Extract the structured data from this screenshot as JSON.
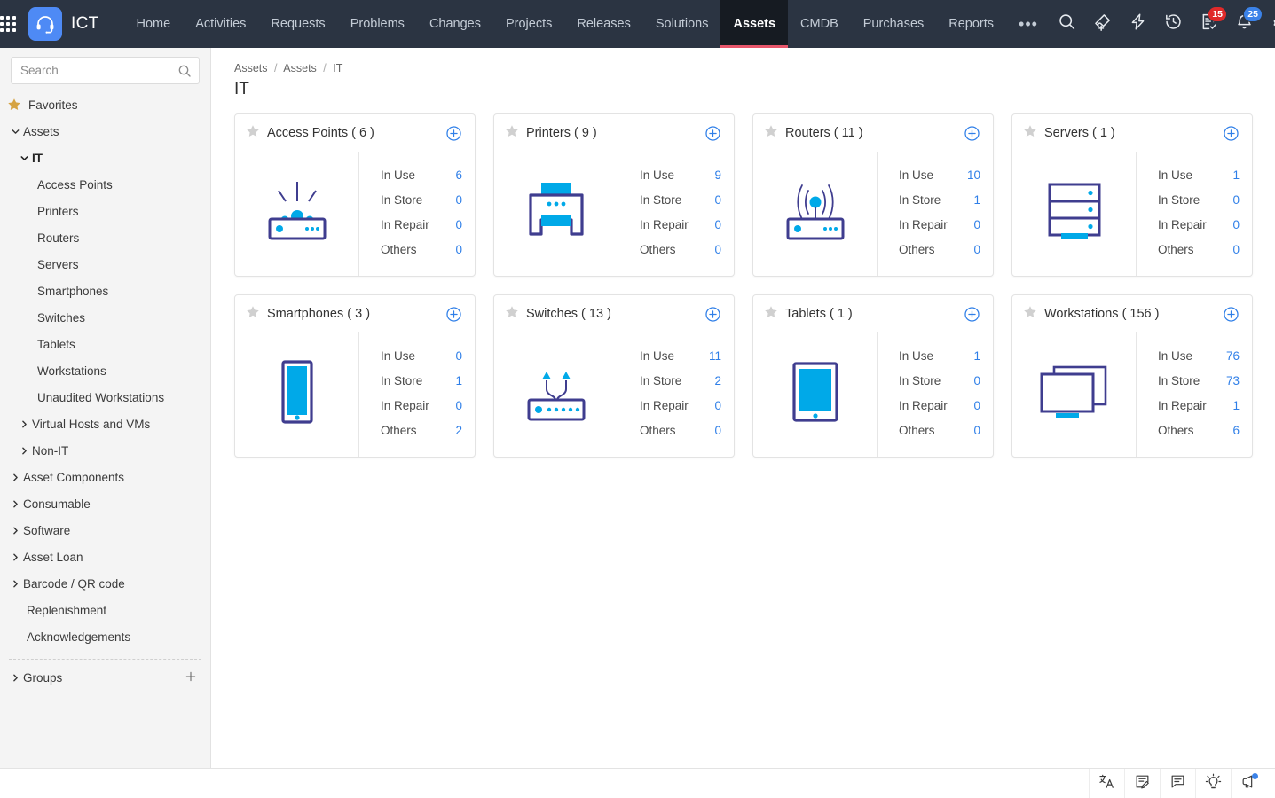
{
  "colors": {
    "nav_bg": "#2b3442",
    "active_tab_bg": "#161b22",
    "accent_red": "#e8566b",
    "brand_blue": "#4e8af5",
    "link_blue": "#2f7fe8",
    "illus_dark": "#3f3d8f",
    "illus_cyan": "#00a9e8",
    "badge_red": "#e02a2a",
    "badge_blue": "#3b82e8",
    "status_green": "#17c13e",
    "favorites_gold": "#d6a341"
  },
  "topbar": {
    "apps_icon": "grid-apps-icon",
    "brand": {
      "name": "ICT",
      "icon": "headset-logo-icon"
    },
    "links": [
      {
        "label": "Home",
        "active": false
      },
      {
        "label": "Activities",
        "active": false
      },
      {
        "label": "Requests",
        "active": false
      },
      {
        "label": "Problems",
        "active": false
      },
      {
        "label": "Changes",
        "active": false
      },
      {
        "label": "Projects",
        "active": false
      },
      {
        "label": "Releases",
        "active": false
      },
      {
        "label": "Solutions",
        "active": false
      },
      {
        "label": "Assets",
        "active": true
      },
      {
        "label": "CMDB",
        "active": false
      },
      {
        "label": "Purchases",
        "active": false
      },
      {
        "label": "Reports",
        "active": false
      }
    ],
    "more_label": "•••",
    "icons": [
      {
        "name": "search-icon",
        "badge": null
      },
      {
        "name": "add-ticket-icon",
        "badge": null
      },
      {
        "name": "quick-actions-lightning-icon",
        "badge": null
      },
      {
        "name": "history-clock-icon",
        "badge": null
      },
      {
        "name": "my-tasks-icon",
        "badge": "15",
        "badge_color": "red"
      },
      {
        "name": "notifications-bell-icon",
        "badge": "25",
        "badge_color": "blue"
      },
      {
        "name": "settings-gear-icon",
        "badge": null
      }
    ],
    "avatar": {
      "name": "user-avatar",
      "status": "online"
    }
  },
  "sidebar": {
    "search": {
      "placeholder": "Search",
      "value": "",
      "icon": "search-icon"
    },
    "favorites": {
      "label": "Favorites",
      "icon": "star-favorites-icon"
    },
    "tree": [
      {
        "label": "Assets",
        "level": 0,
        "expandable": true,
        "expanded": true,
        "bold": false
      },
      {
        "label": "IT",
        "level": 1,
        "expandable": true,
        "expanded": true,
        "bold": true
      },
      {
        "label": "Access Points",
        "level": 2,
        "expandable": false,
        "expanded": false,
        "bold": false
      },
      {
        "label": "Printers",
        "level": 2,
        "expandable": false,
        "expanded": false,
        "bold": false
      },
      {
        "label": "Routers",
        "level": 2,
        "expandable": false,
        "expanded": false,
        "bold": false
      },
      {
        "label": "Servers",
        "level": 2,
        "expandable": false,
        "expanded": false,
        "bold": false
      },
      {
        "label": "Smartphones",
        "level": 2,
        "expandable": false,
        "expanded": false,
        "bold": false
      },
      {
        "label": "Switches",
        "level": 2,
        "expandable": false,
        "expanded": false,
        "bold": false
      },
      {
        "label": "Tablets",
        "level": 2,
        "expandable": false,
        "expanded": false,
        "bold": false
      },
      {
        "label": "Workstations",
        "level": 2,
        "expandable": false,
        "expanded": false,
        "bold": false
      },
      {
        "label": "Unaudited Workstations",
        "level": 2,
        "expandable": false,
        "expanded": false,
        "bold": false
      },
      {
        "label": "Virtual Hosts and VMs",
        "level": 1,
        "expandable": true,
        "expanded": false,
        "bold": false
      },
      {
        "label": "Non-IT",
        "level": 1,
        "expandable": true,
        "expanded": false,
        "bold": false
      },
      {
        "label": "Asset Components",
        "level": 0,
        "expandable": true,
        "expanded": false,
        "bold": false
      },
      {
        "label": "Consumable",
        "level": 0,
        "expandable": true,
        "expanded": false,
        "bold": false
      },
      {
        "label": "Software",
        "level": 0,
        "expandable": true,
        "expanded": false,
        "bold": false
      },
      {
        "label": "Asset Loan",
        "level": 0,
        "expandable": true,
        "expanded": false,
        "bold": false
      },
      {
        "label": "Barcode / QR code",
        "level": 0,
        "expandable": true,
        "expanded": false,
        "bold": false
      },
      {
        "label": "Replenishment",
        "level": 0,
        "expandable": false,
        "expanded": false,
        "bold": false
      },
      {
        "label": "Acknowledgements",
        "level": 0,
        "expandable": false,
        "expanded": false,
        "bold": false
      }
    ],
    "groups": {
      "label": "Groups",
      "add_icon": "plus-icon"
    }
  },
  "main": {
    "breadcrumb": [
      "Assets",
      "Assets",
      "IT"
    ],
    "breadcrumb_separator": "/",
    "title": "IT",
    "stat_labels": [
      "In Use",
      "In Store",
      "In Repair",
      "Others"
    ],
    "cards": [
      {
        "title": "Access Points ( 6 )",
        "name": "access-points",
        "icon": "access-point-illustration",
        "favorited": false,
        "add_icon": "plus-circle-icon",
        "stats": [
          {
            "label": "In Use",
            "value": "6"
          },
          {
            "label": "In Store",
            "value": "0"
          },
          {
            "label": "In Repair",
            "value": "0"
          },
          {
            "label": "Others",
            "value": "0"
          }
        ]
      },
      {
        "title": "Printers ( 9 )",
        "name": "printers",
        "icon": "printer-illustration",
        "favorited": false,
        "add_icon": "plus-circle-icon",
        "stats": [
          {
            "label": "In Use",
            "value": "9"
          },
          {
            "label": "In Store",
            "value": "0"
          },
          {
            "label": "In Repair",
            "value": "0"
          },
          {
            "label": "Others",
            "value": "0"
          }
        ]
      },
      {
        "title": "Routers ( 11 )",
        "name": "routers",
        "icon": "router-illustration",
        "favorited": false,
        "add_icon": "plus-circle-icon",
        "stats": [
          {
            "label": "In Use",
            "value": "10"
          },
          {
            "label": "In Store",
            "value": "1"
          },
          {
            "label": "In Repair",
            "value": "0"
          },
          {
            "label": "Others",
            "value": "0"
          }
        ]
      },
      {
        "title": "Servers ( 1 )",
        "name": "servers",
        "icon": "server-rack-illustration",
        "favorited": false,
        "add_icon": "plus-circle-icon",
        "stats": [
          {
            "label": "In Use",
            "value": "1"
          },
          {
            "label": "In Store",
            "value": "0"
          },
          {
            "label": "In Repair",
            "value": "0"
          },
          {
            "label": "Others",
            "value": "0"
          }
        ]
      },
      {
        "title": "Smartphones ( 3 )",
        "name": "smartphones",
        "icon": "smartphone-illustration",
        "favorited": false,
        "add_icon": "plus-circle-icon",
        "stats": [
          {
            "label": "In Use",
            "value": "0"
          },
          {
            "label": "In Store",
            "value": "1"
          },
          {
            "label": "In Repair",
            "value": "0"
          },
          {
            "label": "Others",
            "value": "2"
          }
        ]
      },
      {
        "title": "Switches ( 13 )",
        "name": "switches",
        "icon": "network-switch-illustration",
        "favorited": false,
        "add_icon": "plus-circle-icon",
        "stats": [
          {
            "label": "In Use",
            "value": "11"
          },
          {
            "label": "In Store",
            "value": "2"
          },
          {
            "label": "In Repair",
            "value": "0"
          },
          {
            "label": "Others",
            "value": "0"
          }
        ]
      },
      {
        "title": "Tablets ( 1 )",
        "name": "tablets",
        "icon": "tablet-illustration",
        "favorited": false,
        "add_icon": "plus-circle-icon",
        "stats": [
          {
            "label": "In Use",
            "value": "1"
          },
          {
            "label": "In Store",
            "value": "0"
          },
          {
            "label": "In Repair",
            "value": "0"
          },
          {
            "label": "Others",
            "value": "0"
          }
        ]
      },
      {
        "title": "Workstations ( 156 )",
        "name": "workstations",
        "icon": "workstation-illustration",
        "favorited": false,
        "add_icon": "plus-circle-icon",
        "stats": [
          {
            "label": "In Use",
            "value": "76"
          },
          {
            "label": "In Store",
            "value": "73"
          },
          {
            "label": "In Repair",
            "value": "1"
          },
          {
            "label": "Others",
            "value": "6"
          }
        ]
      }
    ]
  },
  "bottombar": {
    "icons": [
      {
        "name": "translate-icon",
        "dot": false
      },
      {
        "name": "edit-note-icon",
        "dot": false
      },
      {
        "name": "chat-icon",
        "dot": false
      },
      {
        "name": "lightbulb-tips-icon",
        "dot": false
      },
      {
        "name": "announcements-megaphone-icon",
        "dot": true
      }
    ]
  }
}
